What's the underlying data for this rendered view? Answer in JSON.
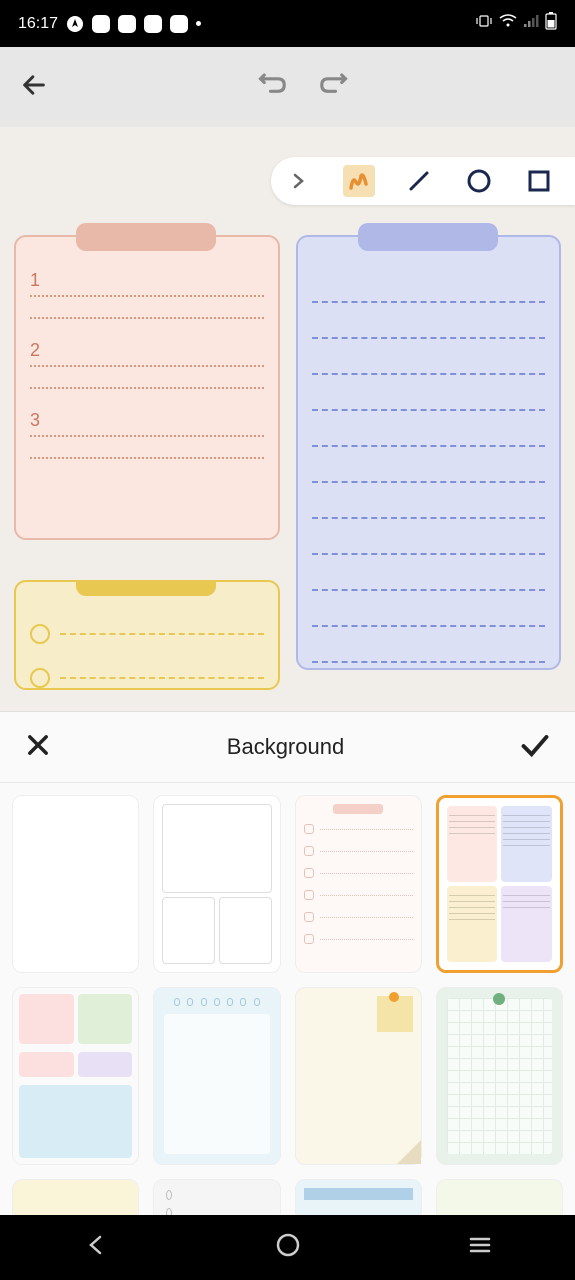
{
  "statusBar": {
    "time": "16:17"
  },
  "panel": {
    "title": "Background"
  },
  "card": {
    "num1": "1",
    "num2": "2",
    "num3": "3"
  },
  "thumbnails": {
    "selected": 3
  }
}
